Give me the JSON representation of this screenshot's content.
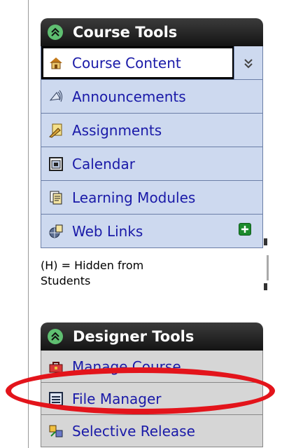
{
  "course_tools": {
    "title": "Course Tools",
    "items": [
      {
        "label": "Course Content",
        "icon": "house-icon",
        "active": true
      },
      {
        "label": "Announcements",
        "icon": "megaphone-icon"
      },
      {
        "label": "Assignments",
        "icon": "assignment-pencil-icon"
      },
      {
        "label": "Calendar",
        "icon": "calendar-icon"
      },
      {
        "label": "Learning Modules",
        "icon": "modules-icon"
      },
      {
        "label": "Web Links",
        "icon": "globe-link-icon"
      }
    ]
  },
  "hidden_note": {
    "line1": "(H) = Hidden from",
    "line2": "Students"
  },
  "designer_tools": {
    "title": "Designer Tools",
    "items": [
      {
        "label": "Manage Course",
        "icon": "toolbox-icon"
      },
      {
        "label": "File Manager",
        "icon": "file-manager-icon"
      },
      {
        "label": "Selective Release",
        "icon": "selective-release-icon"
      }
    ]
  },
  "colors": {
    "highlight": "#e3141b",
    "header": "#1e1e1e",
    "link": "#1a1aa8"
  }
}
